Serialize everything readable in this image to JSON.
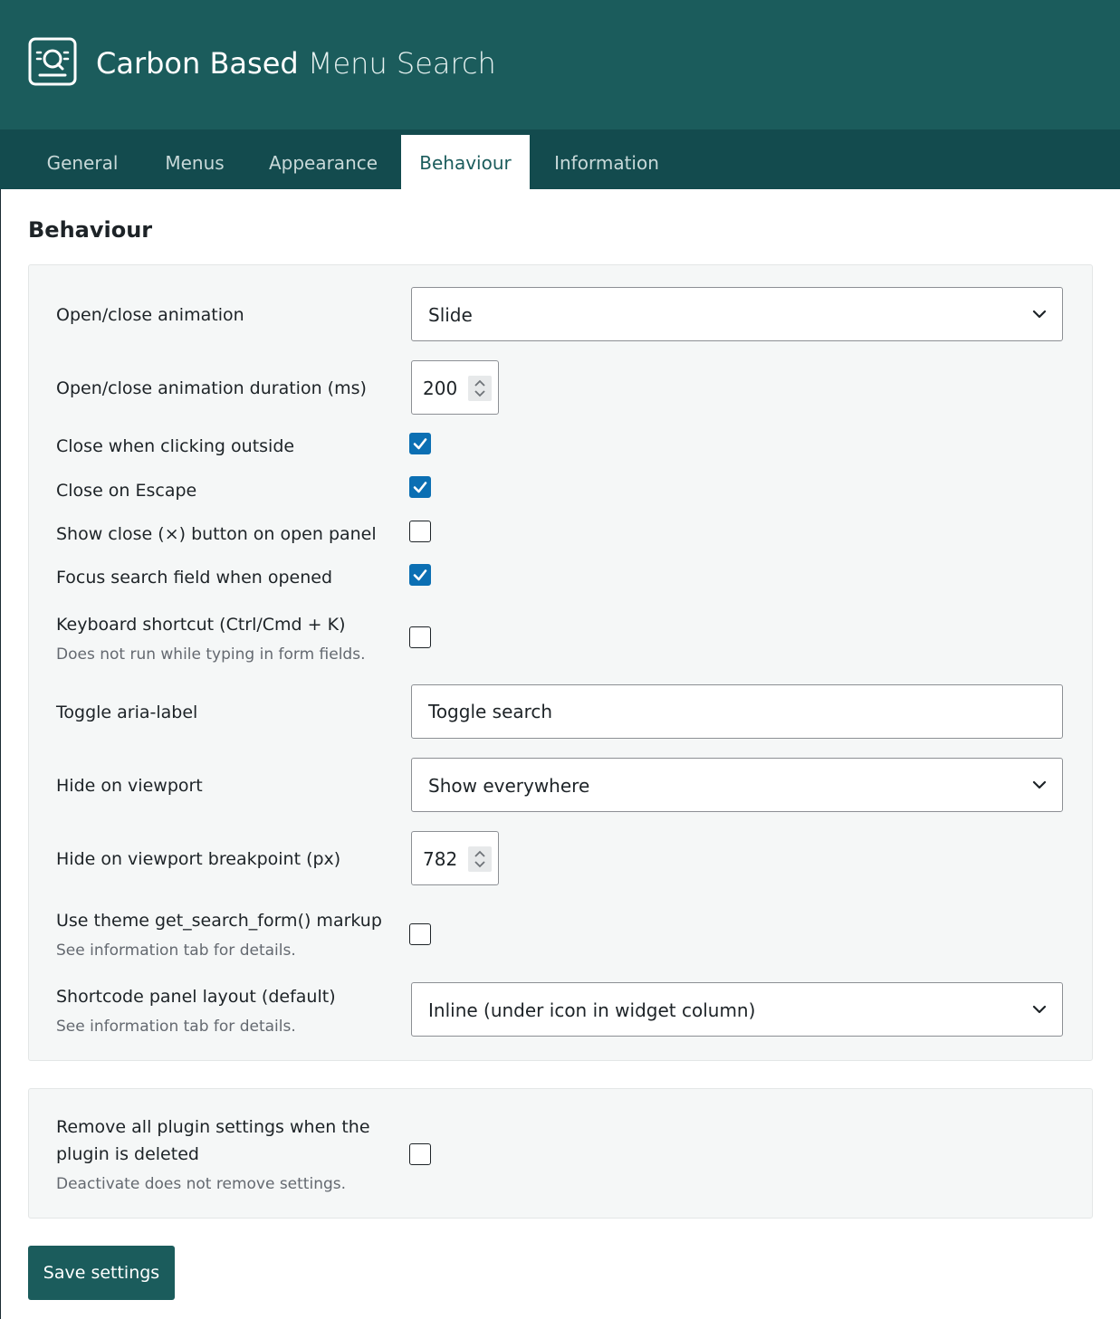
{
  "header": {
    "title_bold": "Carbon Based",
    "title_light": "Menu Search",
    "logo_icon": "search-panel-icon"
  },
  "tabs": [
    {
      "label": "General",
      "active": false
    },
    {
      "label": "Menus",
      "active": false
    },
    {
      "label": "Appearance",
      "active": false
    },
    {
      "label": "Behaviour",
      "active": true
    },
    {
      "label": "Information",
      "active": false
    }
  ],
  "section_title": "Behaviour",
  "settings": {
    "animation": {
      "label": "Open/close animation",
      "value": "Slide"
    },
    "duration": {
      "label": "Open/close animation duration (ms)",
      "value": "200"
    },
    "close_outside": {
      "label": "Close when clicking outside",
      "checked": true
    },
    "close_escape": {
      "label": "Close on Escape",
      "checked": true
    },
    "show_close_button": {
      "label": "Show close (×) button on open panel",
      "checked": false
    },
    "focus_search": {
      "label": "Focus search field when opened",
      "checked": true
    },
    "keyboard_shortcut": {
      "label": "Keyboard shortcut (Ctrl/Cmd + K)",
      "description": "Does not run while typing in form fields.",
      "checked": false
    },
    "toggle_aria_label": {
      "label": "Toggle aria-label",
      "value": "Toggle search"
    },
    "hide_viewport": {
      "label": "Hide on viewport",
      "value": "Show everywhere"
    },
    "hide_breakpoint": {
      "label": "Hide on viewport breakpoint (px)",
      "value": "782"
    },
    "theme_search_form": {
      "label": "Use theme get_search_form() markup",
      "description": "See information tab for details.",
      "checked": false
    },
    "shortcode_layout": {
      "label": "Shortcode panel layout (default)",
      "description": "See information tab for details.",
      "value": "Inline (under icon in widget column)"
    }
  },
  "danger": {
    "remove_settings": {
      "label_line1": "Remove all plugin settings when the",
      "label_line2": "plugin is deleted",
      "description": "Deactivate does not remove settings.",
      "checked": false
    }
  },
  "save_label": "Save settings",
  "colors": {
    "header_bg": "#1b5c5c",
    "tabbar_bg": "#134b4e",
    "checkbox_on": "#0b6fb3",
    "button_bg": "#1b5c5c"
  }
}
